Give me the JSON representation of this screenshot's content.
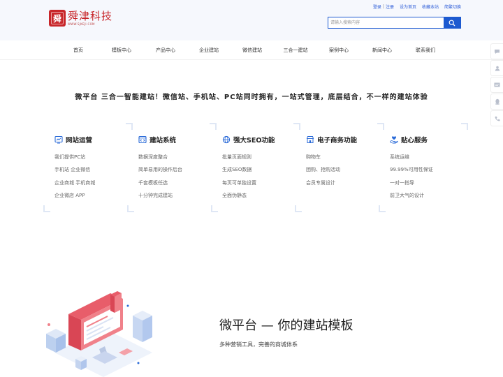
{
  "header": {
    "logo_mark": "舜",
    "logo_text": "舜津科技",
    "logo_sub": "WWW.SJKEJI.COM",
    "top_links": [
      "登录",
      "注册",
      "设为首页",
      "收藏本站",
      "简繁切换"
    ],
    "search_placeholder": "请输入搜索内容"
  },
  "nav": {
    "items": [
      "首页",
      "模板中心",
      "产品中心",
      "企业建站",
      "微信建站",
      "三合一建站",
      "案例中心",
      "新闻中心",
      "联系我们"
    ]
  },
  "slogan": "微平台 三合一智能建站！微信站、手机站、PC站同时拥有，一站式管理，底层结合，不一样的建站体验",
  "features": [
    {
      "title": "网站运营",
      "icon": "chart-board-icon",
      "items": [
        "我们提供PC站",
        "手机站 企业微信",
        "企业商城 手机商城",
        "企业微店 APP"
      ]
    },
    {
      "title": "建站系统",
      "icon": "code-window-icon",
      "items": [
        "数据深度整合",
        "简单易用的操作后台",
        "千套模板任选",
        "十分钟完成建站"
      ]
    },
    {
      "title": "强大SEO功能",
      "icon": "globe-icon",
      "items": [
        "批量页面规则",
        "生成SEO数据",
        "每页可单独设置",
        "全面伪静态"
      ]
    },
    {
      "title": "电子商务功能",
      "icon": "shop-icon",
      "items": [
        "购物车",
        "团购、抢购活动",
        "会员专属设计"
      ]
    },
    {
      "title": "贴心服务",
      "icon": "heart-hand-icon",
      "items": [
        "系统运维",
        "99.99%可用性保证",
        "一对一指导",
        "前卫大气的设计"
      ]
    }
  ],
  "promo": {
    "title": "微平台 — 你的建站模板",
    "subtitle": "多种营销工具，完善的商城体系"
  },
  "colors": {
    "brand_red": "#c8262a",
    "accent_blue": "#1d5ad0",
    "header_bg": "#f6f8fd"
  }
}
